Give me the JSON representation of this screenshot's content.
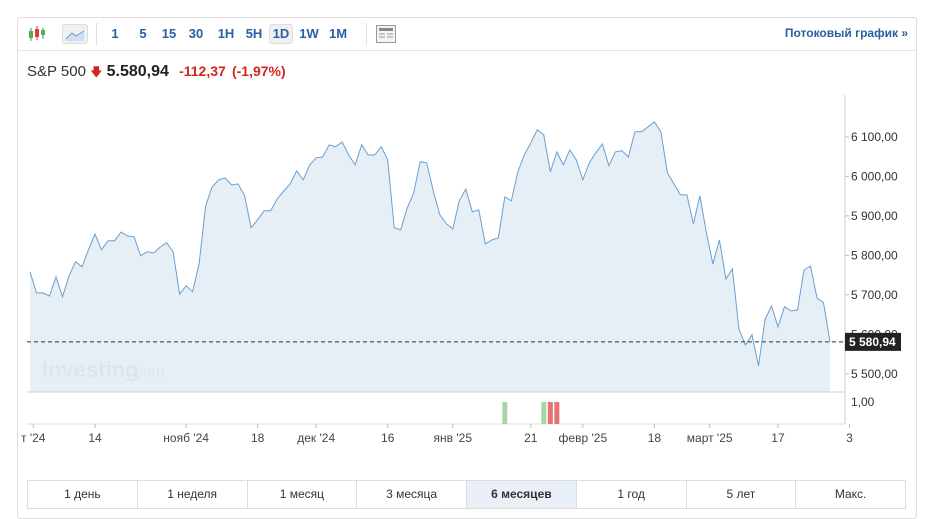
{
  "toolbar": {
    "intervals": [
      "1",
      "5",
      "15",
      "30",
      "1H",
      "5H",
      "1D",
      "1W",
      "1M"
    ],
    "selected": "1D",
    "stream_label": "Потоковый график »"
  },
  "quote": {
    "name": "S&P 500",
    "price": "5.580,94",
    "change": "-112,37",
    "change_pct": "(-1,97%)",
    "direction": "down",
    "color_down": "#d0261c"
  },
  "watermark": {
    "brand": "Investing",
    ".com": ".com"
  },
  "periods": {
    "items": [
      "1 день",
      "1 неделя",
      "1 месяц",
      "3 месяца",
      "6 месяцев",
      "1 год",
      "5 лет",
      "Макс."
    ],
    "selected": "6 месяцев"
  },
  "chart_data": {
    "type": "area",
    "title": "S&P 500",
    "ylim": [
      5454,
      6206
    ],
    "yticks": [
      5500,
      5600,
      5700,
      5800,
      5900,
      6000,
      6100
    ],
    "ytick_labels": [
      "5 500,00",
      "5 600,00",
      "5 700,00",
      "5 800,00",
      "5 900,00",
      "6 000,00",
      "6 100,00"
    ],
    "current_value": 5580.94,
    "current_label": "5 580,94",
    "xticks": [
      {
        "i": 0.5,
        "label": "т '24"
      },
      {
        "i": 10,
        "label": "14"
      },
      {
        "i": 24,
        "label": "нояб '24"
      },
      {
        "i": 35,
        "label": "18"
      },
      {
        "i": 44,
        "label": "дек '24"
      },
      {
        "i": 55,
        "label": "16"
      },
      {
        "i": 65,
        "label": "янв '25"
      },
      {
        "i": 77,
        "label": "21"
      },
      {
        "i": 85,
        "label": "февр '25"
      },
      {
        "i": 96,
        "label": "18"
      },
      {
        "i": 104.5,
        "label": "март '25"
      },
      {
        "i": 115,
        "label": "17"
      },
      {
        "i": 126,
        "label": "3"
      }
    ],
    "values": [
      5758,
      5705,
      5705,
      5697,
      5746,
      5695,
      5748,
      5784,
      5771,
      5814,
      5854,
      5814,
      5837,
      5837,
      5859,
      5849,
      5847,
      5799,
      5809,
      5806,
      5821,
      5832,
      5809,
      5702,
      5723,
      5708,
      5778,
      5925,
      5973,
      5991,
      5996,
      5978,
      5981,
      5951,
      5870,
      5890,
      5913,
      5913,
      5943,
      5963,
      5981,
      6014,
      5991,
      6029,
      6047,
      6049,
      6080,
      6075,
      6087,
      6054,
      6029,
      6080,
      6054,
      6054,
      6075,
      6042,
      5870,
      5865,
      5920,
      5958,
      6037,
      6034,
      5963,
      5903,
      5880,
      5867,
      5938,
      5968,
      5910,
      5915,
      5829,
      5839,
      5844,
      5948,
      5938,
      6011,
      6054,
      6085,
      6118,
      6105,
      6011,
      6062,
      6029,
      6067,
      6042,
      5991,
      6034,
      6060,
      6082,
      6027,
      6062,
      6065,
      6049,
      6113,
      6113,
      6125,
      6138,
      6113,
      6009,
      5981,
      5953,
      5953,
      5880,
      5951,
      5857,
      5778,
      5839,
      5740,
      5766,
      5614,
      5573,
      5599,
      5520,
      5637,
      5672,
      5619,
      5670,
      5659,
      5662,
      5763,
      5773,
      5692,
      5680,
      5581
    ],
    "volume_label": "1,00",
    "volume_bars": [
      {
        "i": 73,
        "dir": "up"
      },
      {
        "i": 79,
        "dir": "up"
      },
      {
        "i": 80,
        "dir": "down"
      },
      {
        "i": 81,
        "dir": "down"
      }
    ]
  }
}
